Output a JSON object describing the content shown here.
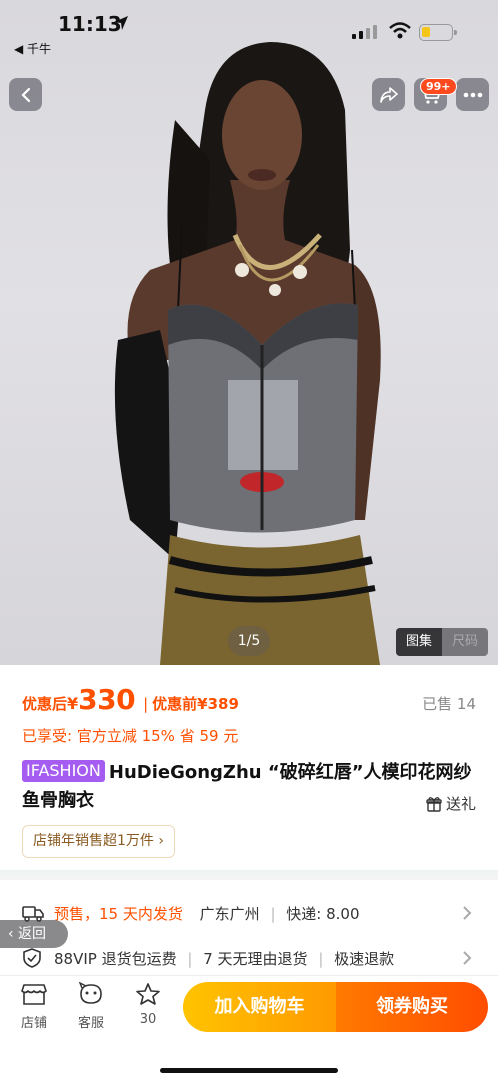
{
  "status_bar": {
    "time": "11:13",
    "back_app": "◀ 千牛"
  },
  "top_actions": {
    "cart_badge": "99+"
  },
  "gallery": {
    "counter": "1/5",
    "tabs": [
      "图集",
      "尺码"
    ]
  },
  "price": {
    "after_label": "优惠后",
    "currency": "¥",
    "after_value": "330",
    "separator": "|",
    "before_label": "优惠前¥389",
    "sold": "已售 14",
    "discount_line": "已享受: 官方立减 15% 省 59 元"
  },
  "product": {
    "brand_tag": "IFASHION",
    "title": "HuDieGongZhu “破碎红唇”人模印花网纱鱼骨胸衣",
    "gift": "送礼",
    "store_tag": "店铺年销售超1万件 ›"
  },
  "services": {
    "shipping_presale": "预售，15 天内发货",
    "shipping_origin": "广东广州",
    "shipping_fee": "快递: 8.00",
    "guarantee_1": "88VIP 退货包运费",
    "guarantee_2": "7 天无理由退货",
    "guarantee_3": "极速退款"
  },
  "back_pill": "‹ 返回",
  "bottom_bar": {
    "store": "店铺",
    "service": "客服",
    "fav_count": "30",
    "add_cart": "加入购物车",
    "buy": "领券购买"
  },
  "colors": {
    "accent": "#ff5000",
    "brand_tag": "#a55cf0",
    "cart_btn": "#ffb000",
    "buy_btn": "#ff5a00"
  }
}
